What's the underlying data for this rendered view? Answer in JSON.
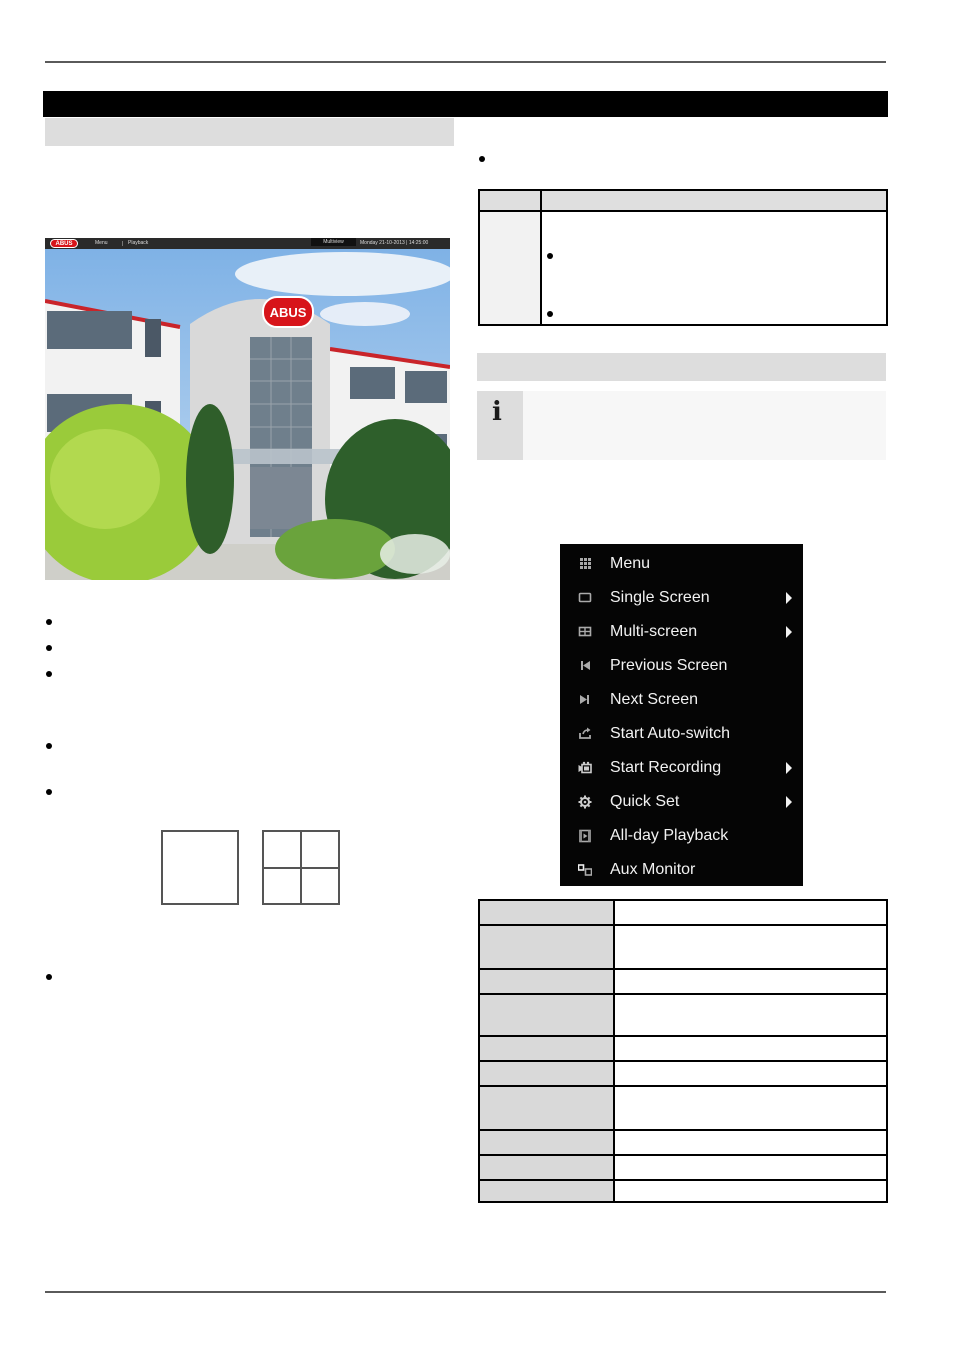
{
  "liveview": {
    "logo": "ABUS",
    "menu": "Menu",
    "playback": "Playback",
    "multiview": "Multiview",
    "datetime": "Monday 21-10-2013 | 14:25:00",
    "sign": "ABUS"
  },
  "note": {
    "icon": "i"
  },
  "context_menu": {
    "items": [
      {
        "label": "Menu",
        "icon": "grid-icon",
        "submenu": false
      },
      {
        "label": "Single Screen",
        "icon": "single-screen-icon",
        "submenu": true
      },
      {
        "label": "Multi-screen",
        "icon": "multi-screen-icon",
        "submenu": true
      },
      {
        "label": "Previous Screen",
        "icon": "previous-icon",
        "submenu": false
      },
      {
        "label": "Next Screen",
        "icon": "next-icon",
        "submenu": false
      },
      {
        "label": "Start Auto-switch",
        "icon": "auto-switch-icon",
        "submenu": false
      },
      {
        "label": "Start Recording",
        "icon": "recording-icon",
        "submenu": true
      },
      {
        "label": "Quick Set",
        "icon": "gear-icon",
        "submenu": true
      },
      {
        "label": "All-day Playback",
        "icon": "playback-icon",
        "submenu": false
      },
      {
        "label": "Aux Monitor",
        "icon": "aux-monitor-icon",
        "submenu": false
      }
    ]
  },
  "menu_table": {
    "rows": [
      {
        "key": "",
        "value": ""
      },
      {
        "key": "",
        "value": ""
      },
      {
        "key": "",
        "value": ""
      },
      {
        "key": "",
        "value": ""
      },
      {
        "key": "",
        "value": ""
      },
      {
        "key": "",
        "value": ""
      },
      {
        "key": "",
        "value": ""
      },
      {
        "key": "",
        "value": ""
      },
      {
        "key": "",
        "value": ""
      },
      {
        "key": "",
        "value": ""
      }
    ]
  }
}
